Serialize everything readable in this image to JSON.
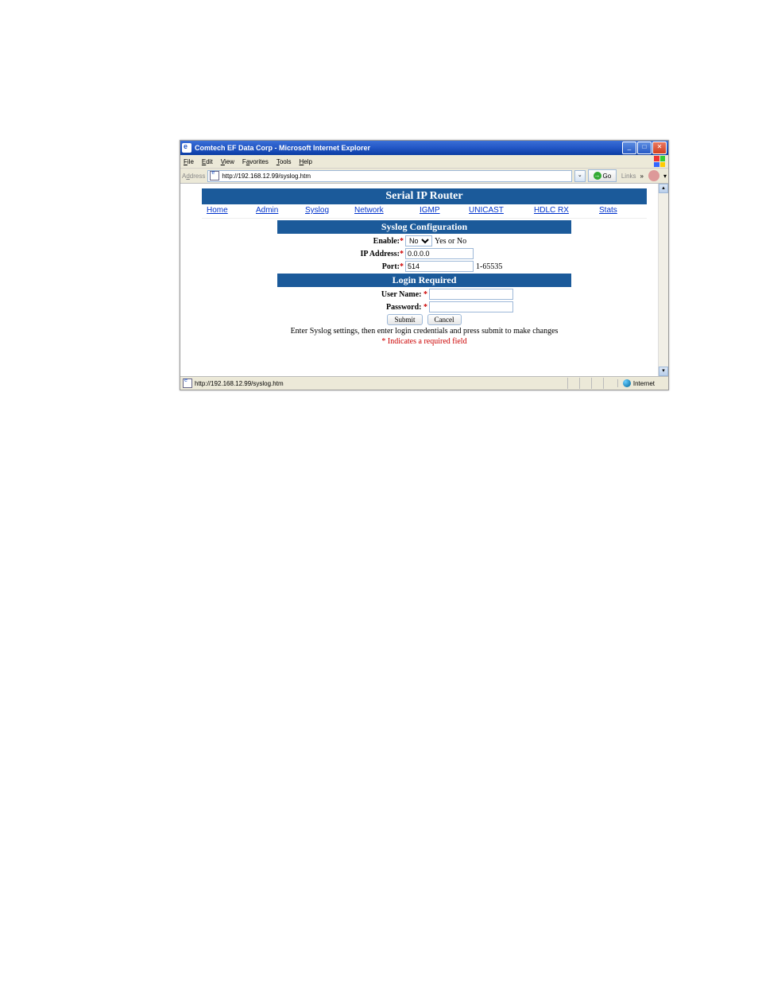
{
  "window": {
    "title": "Comtech EF Data Corp - Microsoft Internet Explorer"
  },
  "menu": {
    "file": "File",
    "edit": "Edit",
    "view": "View",
    "favorites": "Favorites",
    "tools": "Tools",
    "help": "Help"
  },
  "address": {
    "label": "Address",
    "url": "http://192.168.12.99/syslog.htm",
    "go": "Go",
    "links": "Links"
  },
  "page": {
    "header": "Serial IP Router",
    "nav": {
      "home": "Home",
      "admin": "Admin",
      "syslog": "Syslog",
      "network": "Network",
      "igmp": "IGMP",
      "unicast": "UNICAST",
      "hdlcrx": "HDLC RX",
      "stats": "Stats"
    },
    "syslog": {
      "bar": "Syslog Configuration",
      "enable_label": "Enable:",
      "enable_value": "No",
      "enable_hint": "Yes or No",
      "ip_label": "IP Address:",
      "ip_value": "0.0.0.0",
      "port_label": "Port:",
      "port_value": "514",
      "port_hint": "1-65535"
    },
    "login": {
      "bar": "Login Required",
      "user_label": "User Name: ",
      "pass_label": "Password: ",
      "submit": "Submit",
      "cancel": "Cancel"
    },
    "note1": "Enter Syslog settings, then enter login credentials and press submit to make changes",
    "note2": "* Indicates a required field"
  },
  "status": {
    "url": "http://192.168.12.99/syslog.htm",
    "zone": "Internet"
  }
}
